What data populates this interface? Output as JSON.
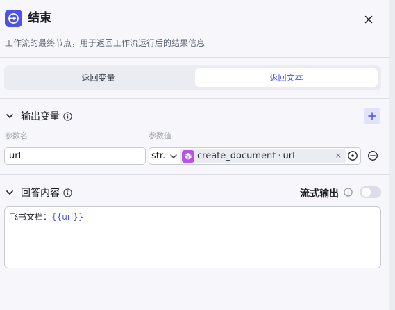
{
  "header": {
    "title": "结束",
    "description": "工作流的最终节点，用于返回工作流运行后的结果信息",
    "node_icon": "end-node-icon",
    "accent_color": "#4d53e8"
  },
  "tabs": {
    "return_variables": "返回变量",
    "return_text": "返回文本",
    "active": "return_text"
  },
  "output_section": {
    "title": "输出变量",
    "param_name_label": "参数名",
    "param_value_label": "参数值",
    "row": {
      "name": "url",
      "type": "str.",
      "ref_node": "create_document",
      "ref_sep": "·",
      "ref_var": "url",
      "ref_clear": "×"
    }
  },
  "answer_section": {
    "title": "回答内容",
    "stream_label": "流式输出",
    "stream_enabled": false,
    "content_prefix": "飞书文档：",
    "content_var": "{{url}}"
  }
}
